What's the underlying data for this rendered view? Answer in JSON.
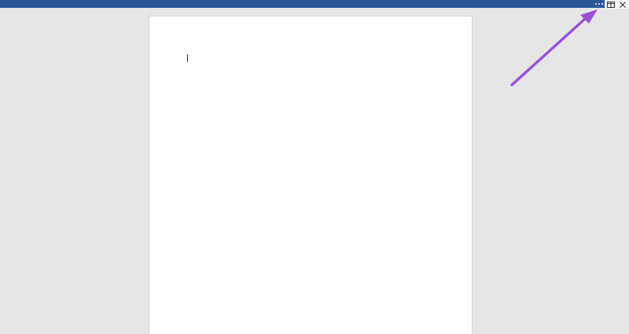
{
  "window": {
    "titlebar_color": "#2b579a",
    "more_options_icon": "ellipsis-icon",
    "reading_mode_icon": "book-icon",
    "close_icon": "close-icon"
  },
  "document": {
    "background_color": "#e6e6e6",
    "page_color": "#ffffff",
    "body_text": ""
  },
  "annotation": {
    "arrow_color": "#9b4fd9"
  }
}
